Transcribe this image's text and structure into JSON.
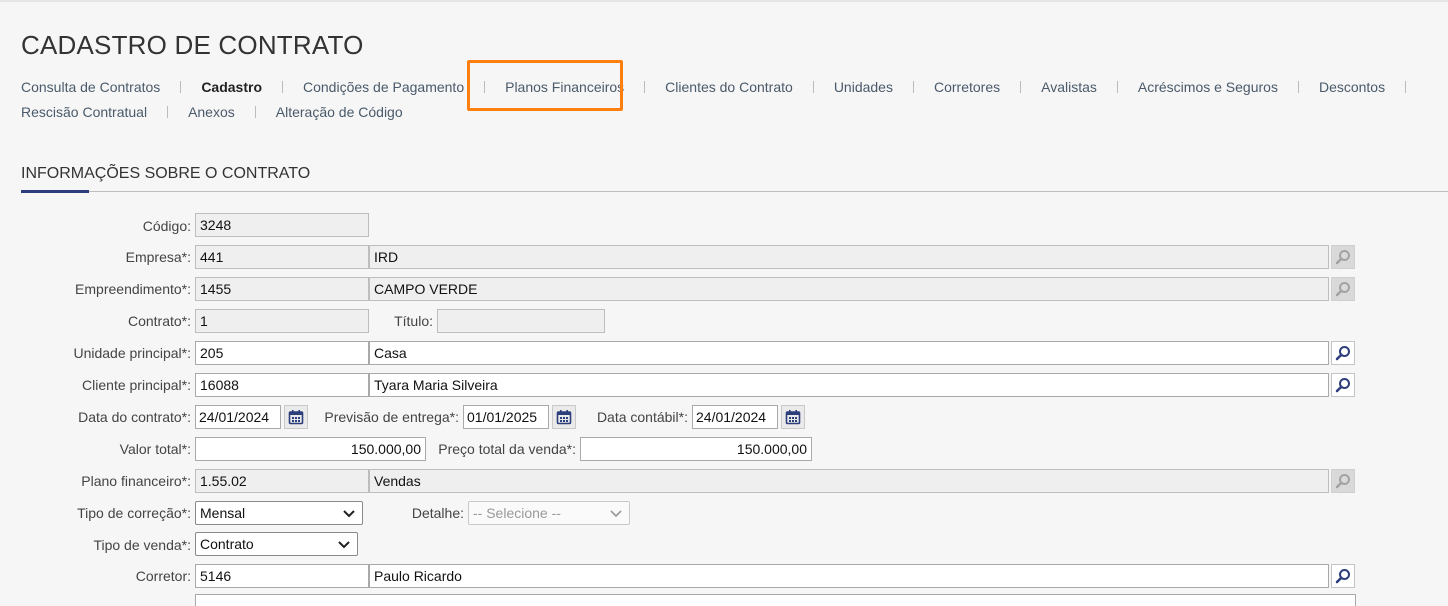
{
  "page": {
    "title": "CADASTRO DE CONTRATO"
  },
  "nav": {
    "row1": [
      "Consulta de Contratos",
      "Cadastro",
      "Condições de Pagamento",
      "Planos Financeiros",
      "Clientes do Contrato",
      "Unidades",
      "Corretores",
      "Avalistas",
      "Acréscimos e Seguros",
      "Descontos"
    ],
    "row2": [
      "Rescisão Contratual",
      "Anexos",
      "Alteração de Código"
    ],
    "active": "Cadastro",
    "highlighted": "Planos Financeiros",
    "highlight_color": "#ff7f0e"
  },
  "section": {
    "title": "INFORMAÇÕES SOBRE O CONTRATO",
    "accent_color": "#2c3e7b"
  },
  "form": {
    "codigo": {
      "label": "Código:",
      "value": "3248"
    },
    "empresa": {
      "label": "Empresa*:",
      "code": "441",
      "name": "IRD"
    },
    "empreendimento": {
      "label": "Empreendimento*:",
      "code": "1455",
      "name": "CAMPO VERDE"
    },
    "contrato": {
      "label": "Contrato*:",
      "value": "1"
    },
    "titulo": {
      "label": "Título:",
      "value": ""
    },
    "unidade": {
      "label": "Unidade principal*:",
      "code": "205",
      "name": "Casa"
    },
    "cliente": {
      "label": "Cliente principal*:",
      "code": "16088",
      "name": "Tyara Maria Silveira"
    },
    "data_contrato": {
      "label": "Data do contrato*:",
      "value": "24/01/2024"
    },
    "previsao": {
      "label": "Previsão de entrega*:",
      "value": "01/01/2025"
    },
    "data_contabil": {
      "label": "Data contábil*:",
      "value": "24/01/2024"
    },
    "valor_total": {
      "label": "Valor total*:",
      "value": "150.000,00"
    },
    "preco_total": {
      "label": "Preço total da venda*:",
      "value": "150.000,00"
    },
    "plano": {
      "label": "Plano financeiro*:",
      "code": "1.55.02",
      "name": "Vendas"
    },
    "tipo_correcao": {
      "label": "Tipo de correção*:",
      "value": "Mensal"
    },
    "detalhe": {
      "label": "Detalhe:",
      "value": "-- Selecione --"
    },
    "tipo_venda": {
      "label": "Tipo de venda*:",
      "value": "Contrato"
    },
    "corretor": {
      "label": "Corretor:",
      "code": "5146",
      "name": "Paulo Ricardo"
    }
  },
  "icons": {
    "search": "magnifier-icon",
    "calendar": "calendar-icon",
    "dropdown": "chevron-down-icon"
  },
  "colors": {
    "icon_active": "#2c3e7b",
    "icon_disabled": "#9a9a9a"
  }
}
